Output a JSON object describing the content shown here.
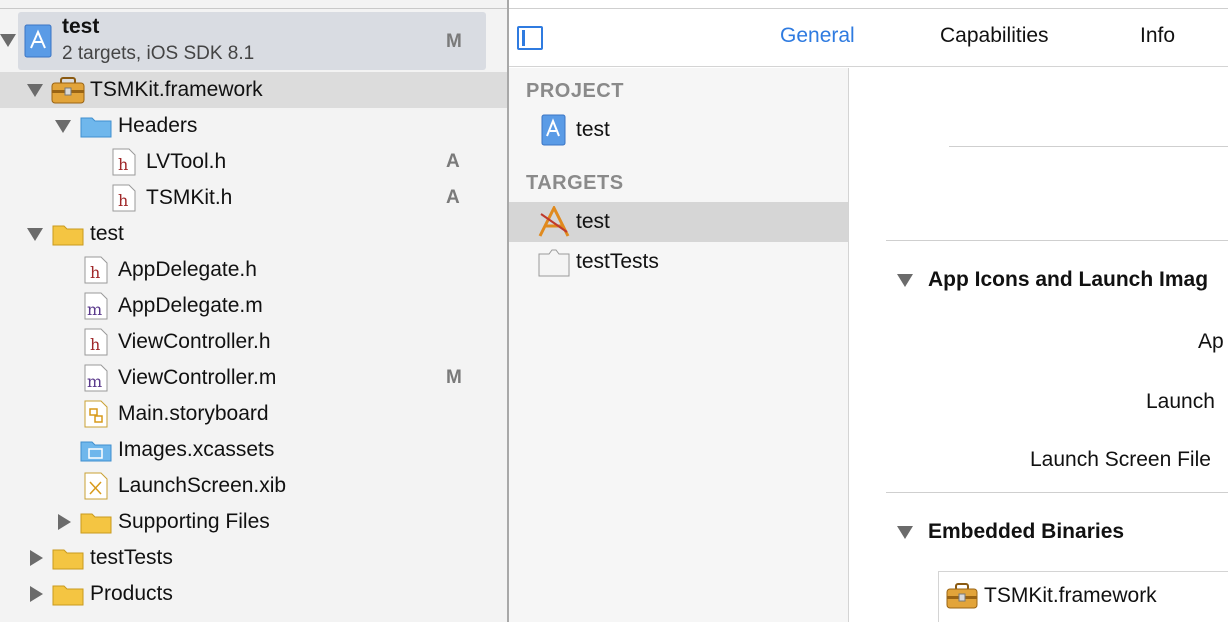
{
  "navigator": {
    "project": {
      "name": "test",
      "subtitle": "2 targets, iOS SDK 8.1",
      "badge": "M",
      "icon": "xcode-project-icon"
    },
    "items": [
      {
        "label": "TSMKit.framework",
        "icon": "framework-toolbox-icon",
        "badge": "",
        "expanded": true
      },
      {
        "label": "Headers",
        "icon": "blue-folder-icon",
        "badge": "",
        "expanded": true
      },
      {
        "label": "LVTool.h",
        "icon": "header-file-icon",
        "badge": "A"
      },
      {
        "label": "TSMKit.h",
        "icon": "header-file-icon",
        "badge": "A"
      },
      {
        "label": "test",
        "icon": "yellow-folder-icon",
        "badge": "",
        "expanded": true
      },
      {
        "label": "AppDelegate.h",
        "icon": "header-file-icon",
        "badge": ""
      },
      {
        "label": "AppDelegate.m",
        "icon": "implementation-file-icon",
        "badge": ""
      },
      {
        "label": "ViewController.h",
        "icon": "header-file-icon",
        "badge": ""
      },
      {
        "label": "ViewController.m",
        "icon": "implementation-file-icon",
        "badge": "M"
      },
      {
        "label": "Main.storyboard",
        "icon": "storyboard-file-icon",
        "badge": ""
      },
      {
        "label": "Images.xcassets",
        "icon": "asset-catalog-icon",
        "badge": ""
      },
      {
        "label": "LaunchScreen.xib",
        "icon": "xib-file-icon",
        "badge": ""
      },
      {
        "label": "Supporting Files",
        "icon": "yellow-folder-icon",
        "badge": "",
        "expanded": false
      },
      {
        "label": "testTests",
        "icon": "yellow-folder-icon",
        "badge": "",
        "expanded": false
      },
      {
        "label": "Products",
        "icon": "yellow-folder-icon",
        "badge": "",
        "expanded": false
      }
    ]
  },
  "editor": {
    "tabs": [
      {
        "label": "General",
        "active": true
      },
      {
        "label": "Capabilities",
        "active": false
      },
      {
        "label": "Info",
        "active": false
      }
    ],
    "project_header": "PROJECT",
    "project_item": "test",
    "targets_header": "TARGETS",
    "targets": [
      {
        "label": "test",
        "icon": "app-target-icon",
        "selected": true
      },
      {
        "label": "testTests",
        "icon": "test-bundle-icon",
        "selected": false
      }
    ]
  },
  "detail": {
    "app_icons_section": "App Icons and Launch Imag",
    "app_icons_fields": [
      "Ap",
      "Launch",
      "Launch Screen File"
    ],
    "embedded_section": "Embedded Binaries",
    "embedded_items": [
      "TSMKit.framework"
    ]
  },
  "colors": {
    "accent": "#2f7be0",
    "selection": "#d9dce2",
    "folder_yellow": "#f4c542",
    "folder_blue": "#6fb7ec",
    "header_red": "#a0282a",
    "impl_purple": "#5b3a8c"
  }
}
